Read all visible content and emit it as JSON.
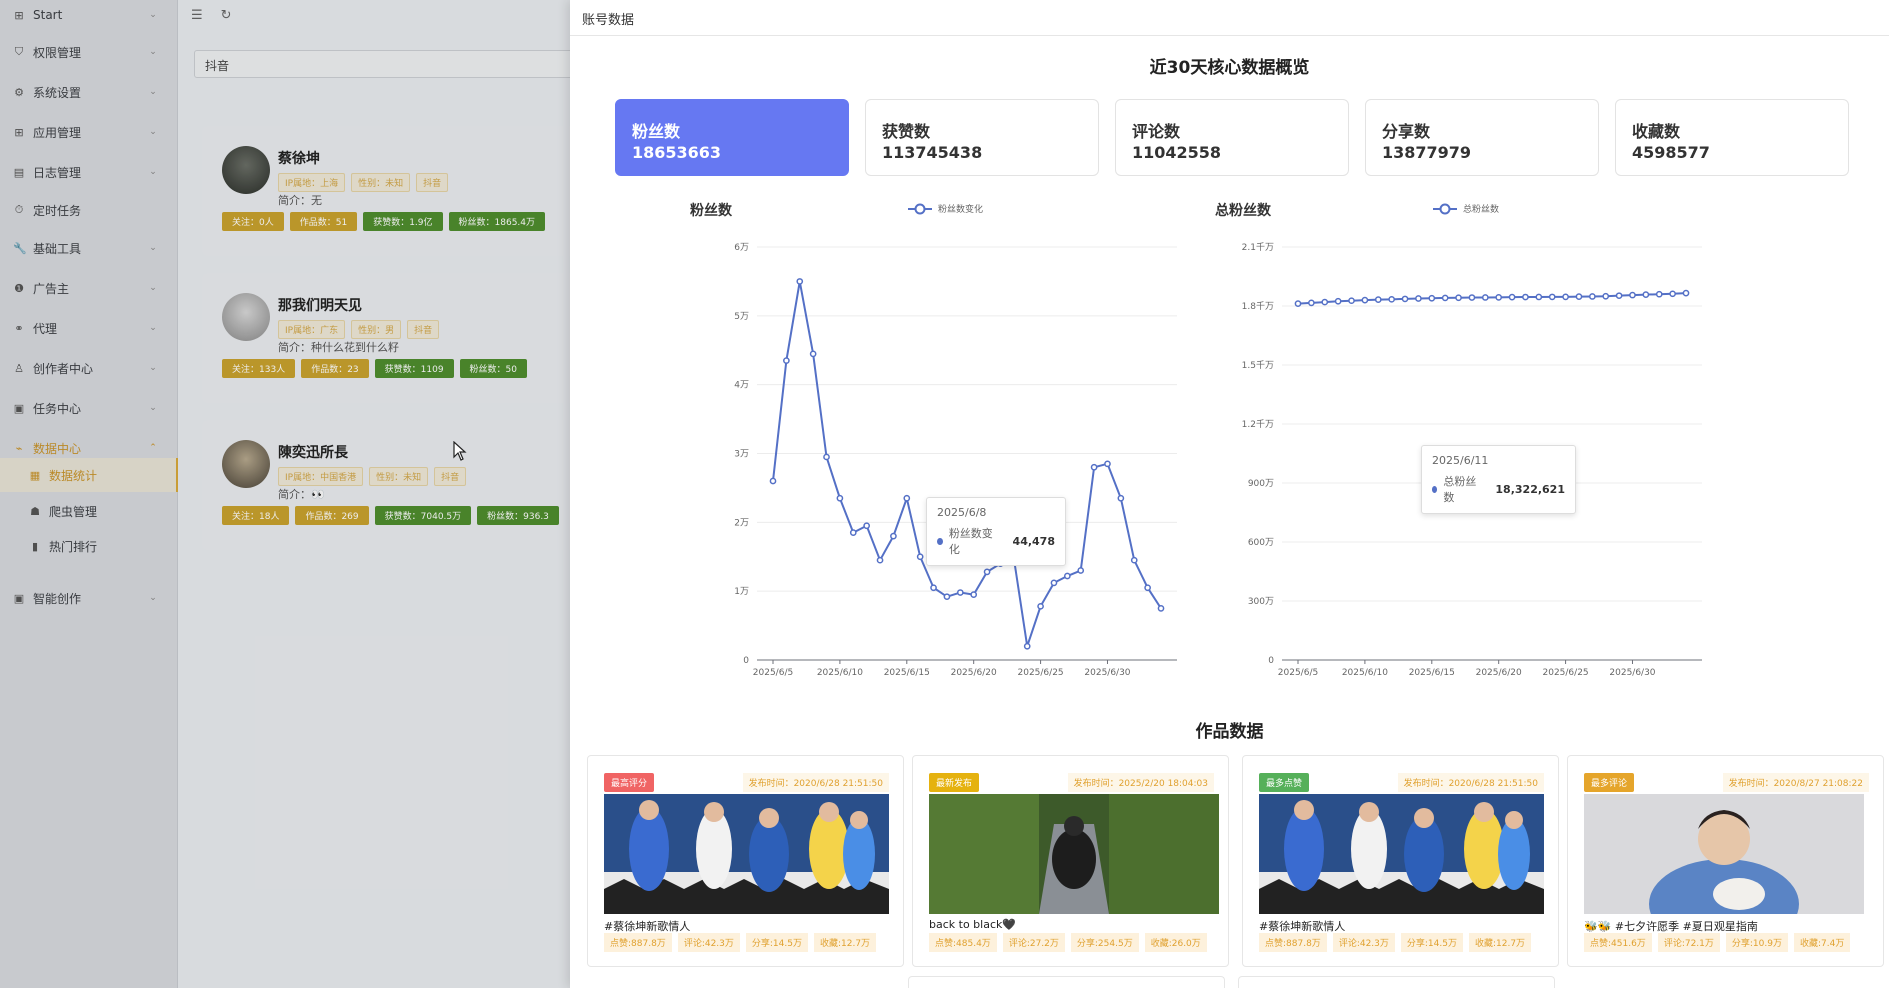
{
  "sidebar": {
    "items": [
      {
        "label": "Start",
        "icon": "grid-icon",
        "glyph": "⊞"
      },
      {
        "label": "权限管理",
        "icon": "shield-icon",
        "glyph": "⛉"
      },
      {
        "label": "系统设置",
        "icon": "gear-icon",
        "glyph": "⚙"
      },
      {
        "label": "应用管理",
        "icon": "apps-icon",
        "glyph": "⊞"
      },
      {
        "label": "日志管理",
        "icon": "doc-icon",
        "glyph": "▤"
      },
      {
        "label": "定时任务",
        "icon": "clock-icon",
        "glyph": "⏱"
      },
      {
        "label": "基础工具",
        "icon": "wrench-icon",
        "glyph": "🔧"
      },
      {
        "label": "广告主",
        "icon": "ad-icon",
        "glyph": "❶"
      },
      {
        "label": "代理",
        "icon": "agent-icon",
        "glyph": "⚭"
      },
      {
        "label": "创作者中心",
        "icon": "user-icon",
        "glyph": "♙"
      },
      {
        "label": "任务中心",
        "icon": "task-icon",
        "glyph": "▣"
      },
      {
        "label": "数据中心",
        "icon": "chart-icon",
        "glyph": "⌁"
      }
    ],
    "subitems": [
      {
        "label": "数据统计",
        "icon": "stats-icon",
        "glyph": "▦"
      },
      {
        "label": "爬虫管理",
        "icon": "bug-icon",
        "glyph": "☗"
      },
      {
        "label": "热门排行",
        "icon": "bar-chart-icon",
        "glyph": "▮"
      }
    ],
    "last": {
      "label": "智能创作",
      "icon": "ai-icon",
      "glyph": "▣"
    }
  },
  "search": {
    "value": "抖音"
  },
  "accounts": [
    {
      "name": "蔡徐坤",
      "tags": [
        "IP属地：上海",
        "性别：未知",
        "抖音"
      ],
      "intro": "简介：无",
      "stats": [
        {
          "t": "关注：0人",
          "c": "y"
        },
        {
          "t": "作品数：51",
          "c": "y"
        },
        {
          "t": "获赞数：1.9亿",
          "c": "g"
        },
        {
          "t": "粉丝数：1865.4万",
          "c": "g"
        }
      ]
    },
    {
      "name": "那我们明天见",
      "tags": [
        "IP属地：广东",
        "性别：男",
        "抖音"
      ],
      "intro": "简介：种什么花到什么籽",
      "stats": [
        {
          "t": "关注：133人",
          "c": "y"
        },
        {
          "t": "作品数：23",
          "c": "y"
        },
        {
          "t": "获赞数：1109",
          "c": "g"
        },
        {
          "t": "粉丝数：50",
          "c": "g"
        }
      ]
    },
    {
      "name": "陳奕迅所長",
      "tags": [
        "IP属地：中国香港",
        "性别：未知",
        "抖音"
      ],
      "intro": "简介：👀",
      "stats": [
        {
          "t": "关注：18人",
          "c": "y"
        },
        {
          "t": "作品数：269",
          "c": "y"
        },
        {
          "t": "获赞数：7040.5万",
          "c": "g"
        },
        {
          "t": "粉丝数：936.3",
          "c": "g"
        }
      ]
    }
  ],
  "drawer": {
    "title": "账号数据",
    "overview_title": "近30天核心数据概览",
    "works_title": "作品数据",
    "metrics": [
      {
        "label": "粉丝数",
        "value": "18653663"
      },
      {
        "label": "获赞数",
        "value": "113745438"
      },
      {
        "label": "评论数",
        "value": "11042558"
      },
      {
        "label": "分享数",
        "value": "13877979"
      },
      {
        "label": "收藏数",
        "value": "4598577"
      }
    ],
    "accent": "#6678f2"
  },
  "chart_data": [
    {
      "type": "line",
      "title": "粉丝数",
      "legend": "粉丝数变化",
      "color": "#5470c6",
      "x_ticks": [
        "2025/6/5",
        "2025/6/10",
        "2025/6/15",
        "2025/6/20",
        "2025/6/25",
        "2025/6/30"
      ],
      "y_ticks": [
        "0",
        "1万",
        "2万",
        "3万",
        "4万",
        "5万",
        "6万"
      ],
      "ylim": [
        0,
        60000
      ],
      "x": [
        "2025/6/5",
        "2025/6/6",
        "2025/6/7",
        "2025/6/8",
        "2025/6/9",
        "2025/6/10",
        "2025/6/11",
        "2025/6/12",
        "2025/6/13",
        "2025/6/14",
        "2025/6/15",
        "2025/6/16",
        "2025/6/17",
        "2025/6/18",
        "2025/6/19",
        "2025/6/20",
        "2025/6/21",
        "2025/6/22",
        "2025/6/23",
        "2025/6/24",
        "2025/6/25",
        "2025/6/26",
        "2025/6/27",
        "2025/6/28",
        "2025/6/29",
        "2025/6/30",
        "2025/7/1",
        "2025/7/2",
        "2025/7/3",
        "2025/7/4"
      ],
      "values": [
        26000,
        43500,
        55000,
        44478,
        29500,
        23500,
        18500,
        19500,
        14500,
        18000,
        23500,
        15000,
        10500,
        9200,
        9800,
        9500,
        12800,
        14000,
        14800,
        2000,
        7800,
        11200,
        12200,
        13000,
        28000,
        28500,
        23500,
        14500,
        10500,
        7500
      ],
      "tooltip": {
        "date": "2025/6/8",
        "name": "粉丝数变化",
        "value": "44,478"
      }
    },
    {
      "type": "line",
      "title": "总粉丝数",
      "legend": "总粉丝数",
      "color": "#5470c6",
      "x_ticks": [
        "2025/6/5",
        "2025/6/10",
        "2025/6/15",
        "2025/6/20",
        "2025/6/25",
        "2025/6/30"
      ],
      "y_ticks": [
        "0",
        "300万",
        "600万",
        "900万",
        "1.2千万",
        "1.5千万",
        "1.8千万",
        "2.1千万"
      ],
      "ylim": [
        0,
        21000000
      ],
      "x": [
        "2025/6/5",
        "2025/6/6",
        "2025/6/7",
        "2025/6/8",
        "2025/6/9",
        "2025/6/10",
        "2025/6/11",
        "2025/6/12",
        "2025/6/13",
        "2025/6/14",
        "2025/6/15",
        "2025/6/16",
        "2025/6/17",
        "2025/6/18",
        "2025/6/19",
        "2025/6/20",
        "2025/6/21",
        "2025/6/22",
        "2025/6/23",
        "2025/6/24",
        "2025/6/25",
        "2025/6/26",
        "2025/6/27",
        "2025/6/28",
        "2025/6/29",
        "2025/6/30",
        "2025/7/1",
        "2025/7/2",
        "2025/7/3",
        "2025/7/4"
      ],
      "values": [
        18120000,
        18160000,
        18200000,
        18240000,
        18270000,
        18300000,
        18322621,
        18340000,
        18360000,
        18380000,
        18395000,
        18410000,
        18420000,
        18430000,
        18435000,
        18440000,
        18450000,
        18455000,
        18460000,
        18462000,
        18465000,
        18475000,
        18485000,
        18495000,
        18525000,
        18555000,
        18580000,
        18600000,
        18620000,
        18653663
      ],
      "tooltip": {
        "date": "2025/6/11",
        "name": "总粉丝数",
        "value": "18,322,621"
      }
    }
  ],
  "works": [
    {
      "badge": "最高评分",
      "badge_color": "#f06464",
      "time": "发布时间：2020/6/28 21:51:50",
      "title": "#蔡徐坤新歌情人",
      "stats": [
        "点赞:887.8万",
        "评论:42.3万",
        "分享:14.5万",
        "收藏:12.7万"
      ],
      "scene": "group"
    },
    {
      "badge": "最新发布",
      "badge_color": "#e5b20f",
      "time": "发布时间：2025/2/20 18:04:03",
      "title": "back to black🖤",
      "stats": [
        "点赞:485.4万",
        "评论:27.2万",
        "分享:254.5万",
        "收藏:26.0万"
      ],
      "scene": "hedge"
    },
    {
      "badge": "最多点赞",
      "badge_color": "#56b05a",
      "time": "发布时间：2020/6/28 21:51:50",
      "title": "#蔡徐坤新歌情人",
      "stats": [
        "点赞:887.8万",
        "评论:42.3万",
        "分享:14.5万",
        "收藏:12.7万"
      ],
      "scene": "group"
    },
    {
      "badge": "最多评论",
      "badge_color": "#e5a52b",
      "time": "发布时间：2020/8/27 21:08:22",
      "title": "🐝🐝 #七夕许愿季 #夏日观星指南",
      "stats": [
        "点赞:451.6万",
        "评论:72.1万",
        "分享:10.9万",
        "收藏:7.4万"
      ],
      "scene": "cat"
    }
  ]
}
